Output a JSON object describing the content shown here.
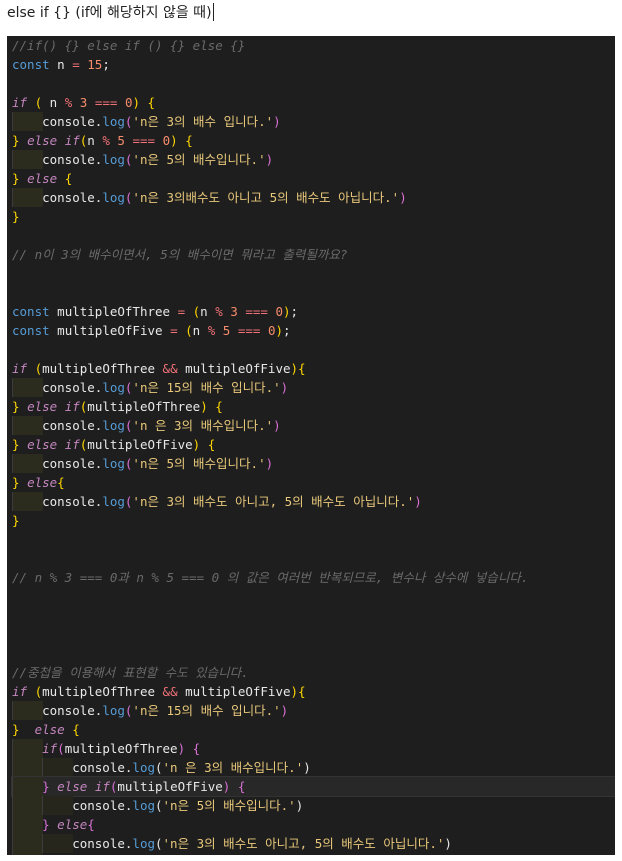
{
  "heading": "else if {} (if에 해당하지 않을 때)",
  "code_lines": [
    [
      [
        "cm",
        "//if() {} else if () {} else {}"
      ]
    ],
    [
      [
        "dec",
        "const"
      ],
      [
        "plain",
        " n "
      ],
      [
        "op",
        "="
      ],
      [
        "plain",
        " "
      ],
      [
        "num",
        "15"
      ],
      [
        "plain",
        ";"
      ]
    ],
    [],
    [
      [
        "kw",
        "if"
      ],
      [
        "plain",
        " "
      ],
      [
        "br1",
        "("
      ],
      [
        "plain",
        " n "
      ],
      [
        "op",
        "%"
      ],
      [
        "plain",
        " "
      ],
      [
        "num",
        "3"
      ],
      [
        "plain",
        " "
      ],
      [
        "op",
        "==="
      ],
      [
        "plain",
        " "
      ],
      [
        "num",
        "0"
      ],
      [
        "br1",
        ")"
      ],
      [
        "plain",
        " "
      ],
      [
        "br1",
        "{"
      ]
    ],
    [
      [
        "plain",
        "    console."
      ],
      [
        "meth",
        "log"
      ],
      [
        "br2",
        "("
      ],
      [
        "str",
        "'n은 3의 배수 입니다.'"
      ],
      [
        "br2",
        ")"
      ]
    ],
    [
      [
        "br1",
        "}"
      ],
      [
        "plain",
        " "
      ],
      [
        "kw",
        "else"
      ],
      [
        "plain",
        " "
      ],
      [
        "kw",
        "if"
      ],
      [
        "br1",
        "("
      ],
      [
        "plain",
        "n "
      ],
      [
        "op",
        "%"
      ],
      [
        "plain",
        " "
      ],
      [
        "num",
        "5"
      ],
      [
        "plain",
        " "
      ],
      [
        "op",
        "==="
      ],
      [
        "plain",
        " "
      ],
      [
        "num",
        "0"
      ],
      [
        "br1",
        ")"
      ],
      [
        "plain",
        " "
      ],
      [
        "br1",
        "{"
      ]
    ],
    [
      [
        "plain",
        "    console."
      ],
      [
        "meth",
        "log"
      ],
      [
        "br2",
        "("
      ],
      [
        "str",
        "'n은 5의 배수입니다.'"
      ],
      [
        "br2",
        ")"
      ]
    ],
    [
      [
        "br1",
        "}"
      ],
      [
        "plain",
        " "
      ],
      [
        "kw",
        "else"
      ],
      [
        "plain",
        " "
      ],
      [
        "br1",
        "{"
      ]
    ],
    [
      [
        "plain",
        "    console."
      ],
      [
        "meth",
        "log"
      ],
      [
        "br2",
        "("
      ],
      [
        "str",
        "'n은 3의배수도 아니고 5의 배수도 아닙니다.'"
      ],
      [
        "br2",
        ")"
      ]
    ],
    [
      [
        "br1",
        "}"
      ]
    ],
    [],
    [
      [
        "cm",
        "// n이 3의 배수이면서, 5의 배수이면 뭐라고 출력될까요?"
      ]
    ],
    [],
    [],
    [
      [
        "dec",
        "const"
      ],
      [
        "plain",
        " multipleOfThree "
      ],
      [
        "op",
        "="
      ],
      [
        "plain",
        " "
      ],
      [
        "br1",
        "("
      ],
      [
        "plain",
        "n "
      ],
      [
        "op",
        "%"
      ],
      [
        "plain",
        " "
      ],
      [
        "num",
        "3"
      ],
      [
        "plain",
        " "
      ],
      [
        "op",
        "==="
      ],
      [
        "plain",
        " "
      ],
      [
        "num",
        "0"
      ],
      [
        "br1",
        ")"
      ],
      [
        "plain",
        ";"
      ]
    ],
    [
      [
        "dec",
        "const"
      ],
      [
        "plain",
        " multipleOfFive "
      ],
      [
        "op",
        "="
      ],
      [
        "plain",
        " "
      ],
      [
        "br1",
        "("
      ],
      [
        "plain",
        "n "
      ],
      [
        "op",
        "%"
      ],
      [
        "plain",
        " "
      ],
      [
        "num",
        "5"
      ],
      [
        "plain",
        " "
      ],
      [
        "op",
        "==="
      ],
      [
        "plain",
        " "
      ],
      [
        "num",
        "0"
      ],
      [
        "br1",
        ")"
      ],
      [
        "plain",
        ";"
      ]
    ],
    [],
    [
      [
        "kw",
        "if"
      ],
      [
        "plain",
        " "
      ],
      [
        "br1",
        "("
      ],
      [
        "plain",
        "multipleOfThree "
      ],
      [
        "op",
        "&&"
      ],
      [
        "plain",
        " multipleOfFive"
      ],
      [
        "br1",
        ")"
      ],
      [
        "br1",
        "{"
      ]
    ],
    [
      [
        "plain",
        "    console."
      ],
      [
        "meth",
        "log"
      ],
      [
        "br2",
        "("
      ],
      [
        "str",
        "'n은 15의 배수 입니다.'"
      ],
      [
        "br2",
        ")"
      ]
    ],
    [
      [
        "br1",
        "}"
      ],
      [
        "plain",
        " "
      ],
      [
        "kw",
        "else"
      ],
      [
        "plain",
        " "
      ],
      [
        "kw",
        "if"
      ],
      [
        "br1",
        "("
      ],
      [
        "plain",
        "multipleOfThree"
      ],
      [
        "br1",
        ")"
      ],
      [
        "plain",
        " "
      ],
      [
        "br1",
        "{"
      ]
    ],
    [
      [
        "plain",
        "    console."
      ],
      [
        "meth",
        "log"
      ],
      [
        "br2",
        "("
      ],
      [
        "str",
        "'n 은 3의 배수입니다.'"
      ],
      [
        "br2",
        ")"
      ]
    ],
    [
      [
        "br1",
        "}"
      ],
      [
        "plain",
        " "
      ],
      [
        "kw",
        "else"
      ],
      [
        "plain",
        " "
      ],
      [
        "kw",
        "if"
      ],
      [
        "br1",
        "("
      ],
      [
        "plain",
        "multipleOfFive"
      ],
      [
        "br1",
        ")"
      ],
      [
        "plain",
        " "
      ],
      [
        "br1",
        "{"
      ]
    ],
    [
      [
        "plain",
        "    console."
      ],
      [
        "meth",
        "log"
      ],
      [
        "br2",
        "("
      ],
      [
        "str",
        "'n은 5의 배수입니다.'"
      ],
      [
        "br2",
        ")"
      ]
    ],
    [
      [
        "br1",
        "}"
      ],
      [
        "plain",
        " "
      ],
      [
        "kw",
        "else"
      ],
      [
        "br1",
        "{"
      ]
    ],
    [
      [
        "plain",
        "    console."
      ],
      [
        "meth",
        "log"
      ],
      [
        "br2",
        "("
      ],
      [
        "str",
        "'n은 3의 배수도 아니고, 5의 배수도 아닙니다.'"
      ],
      [
        "br2",
        ")"
      ]
    ],
    [
      [
        "br1",
        "}"
      ]
    ],
    [],
    [],
    [
      [
        "cm",
        "// n % 3 === 0과 n % 5 === 0 의 값은 여러번 반복되므로, 변수나 상수에 넣습니다."
      ]
    ],
    [],
    [],
    [],
    [],
    [
      [
        "cm",
        "//중첩을 이용해서 표현할 수도 있습니다."
      ]
    ],
    [
      [
        "kw",
        "if"
      ],
      [
        "plain",
        " "
      ],
      [
        "br1",
        "("
      ],
      [
        "plain",
        "multipleOfThree "
      ],
      [
        "op",
        "&&"
      ],
      [
        "plain",
        " multipleOfFive"
      ],
      [
        "br1",
        ")"
      ],
      [
        "br1",
        "{"
      ]
    ],
    [
      [
        "plain",
        "    console."
      ],
      [
        "meth",
        "log"
      ],
      [
        "br2",
        "("
      ],
      [
        "str",
        "'n은 15의 배수 입니다.'"
      ],
      [
        "br2",
        ")"
      ]
    ],
    [
      [
        "br1",
        "}"
      ],
      [
        "plain",
        "  "
      ],
      [
        "kw",
        "else"
      ],
      [
        "plain",
        " "
      ],
      [
        "br1",
        "{"
      ]
    ],
    [
      [
        "plain",
        "    "
      ],
      [
        "kw",
        "if"
      ],
      [
        "br2",
        "("
      ],
      [
        "plain",
        "multipleOfThree"
      ],
      [
        "br2",
        ")"
      ],
      [
        "plain",
        " "
      ],
      [
        "br2",
        "{"
      ]
    ],
    [
      [
        "plain",
        "        console."
      ],
      [
        "meth",
        "log"
      ],
      [
        "plain",
        "("
      ],
      [
        "str",
        "'n 은 3의 배수입니다.'"
      ],
      [
        "plain",
        ")"
      ]
    ],
    [
      [
        "plain",
        "    "
      ],
      [
        "br2",
        "}"
      ],
      [
        "plain",
        " "
      ],
      [
        "kw",
        "else"
      ],
      [
        "plain",
        " "
      ],
      [
        "kw",
        "if"
      ],
      [
        "br2",
        "("
      ],
      [
        "plain",
        "multipleOfFive"
      ],
      [
        "br2",
        ")"
      ],
      [
        "plain",
        " "
      ],
      [
        "br2",
        "{"
      ]
    ],
    [
      [
        "plain",
        "        console."
      ],
      [
        "meth",
        "log"
      ],
      [
        "plain",
        "("
      ],
      [
        "str",
        "'n은 5의 배수입니다.'"
      ],
      [
        "plain",
        ")"
      ]
    ],
    [
      [
        "plain",
        "    "
      ],
      [
        "br2",
        "}"
      ],
      [
        "plain",
        " "
      ],
      [
        "kw",
        "else"
      ],
      [
        "br2",
        "{"
      ]
    ],
    [
      [
        "plain",
        "        console."
      ],
      [
        "meth",
        "log"
      ],
      [
        "plain",
        "("
      ],
      [
        "str",
        "'n은 3의 배수도 아니고, 5의 배수도 아닙니다.'"
      ],
      [
        "plain",
        ")"
      ]
    ],
    [
      [
        "plain",
        "    "
      ],
      [
        "br2",
        "}"
      ]
    ],
    [
      [
        "br1",
        "}"
      ]
    ]
  ],
  "active_line": 39
}
